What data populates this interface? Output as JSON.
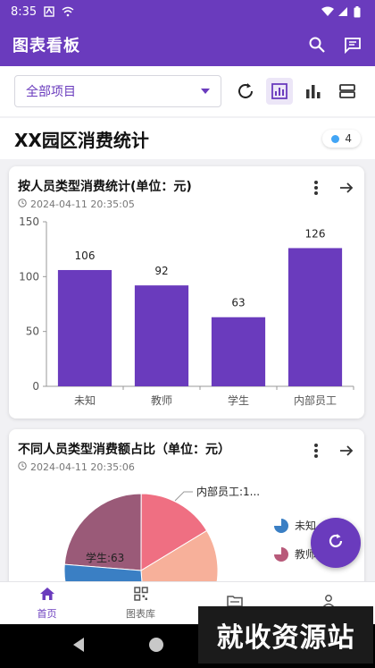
{
  "status_bar": {
    "time": "8:35",
    "status_icons": [
      "sim-icon",
      "wifi-icon",
      "signal-icon",
      "battery-icon"
    ]
  },
  "app_bar": {
    "title": "图表看板",
    "icons": [
      "search-icon",
      "message-icon"
    ]
  },
  "toolbar": {
    "select_value": "全部项目",
    "icons": [
      "refresh-icon",
      "chart-frame-icon",
      "bar-chart-icon",
      "list-view-icon"
    ]
  },
  "section": {
    "title": "XX园区消费统计",
    "count": "4",
    "dot_color": "#42a5f5"
  },
  "cards": [
    {
      "title": "按人员类型消费统计(单位：元)",
      "time": "2024-04-11 20:35:05"
    },
    {
      "title": "不同人员类型消费额占比（单位：元）",
      "time": "2024-04-11 20:35:06"
    }
  ],
  "chart_data": [
    {
      "type": "bar",
      "title": "按人员类型消费统计(单位：元)",
      "categories": [
        "未知",
        "教师",
        "学生",
        "内部员工"
      ],
      "values": [
        106,
        92,
        63,
        126
      ],
      "yticks": [
        0,
        50,
        100,
        150
      ],
      "ylim": [
        0,
        150
      ],
      "color": "#6a3bbd",
      "grid": false
    },
    {
      "type": "pie",
      "title": "不同人员类型消费额占比（单位：元）",
      "slices": [
        {
          "label": "内部员工",
          "value": 126,
          "color": "#f7b09a",
          "callout": "内部员工:1..."
        },
        {
          "label": "学生",
          "value": 63,
          "color": "#ef6f82",
          "callout": "学生:63"
        },
        {
          "label": "教师",
          "value": 92,
          "color": "#9a5a78"
        },
        {
          "label": "未知",
          "value": 106,
          "color": "#3a7fc4"
        }
      ],
      "legend": [
        {
          "label": "未知",
          "color": "#3a7fc4"
        },
        {
          "label": "教师",
          "color": "#b85a7a"
        }
      ]
    }
  ],
  "bottom_nav": [
    {
      "label": "首页",
      "icon": "home-icon",
      "active": true
    },
    {
      "label": "图表库",
      "icon": "grid-icon",
      "active": false
    },
    {
      "label": "",
      "icon": "folder-icon",
      "active": false
    },
    {
      "label": "",
      "icon": "person-icon",
      "active": false
    }
  ],
  "watermark": "就收资源站",
  "colors": {
    "primary": "#6a3bbd"
  }
}
